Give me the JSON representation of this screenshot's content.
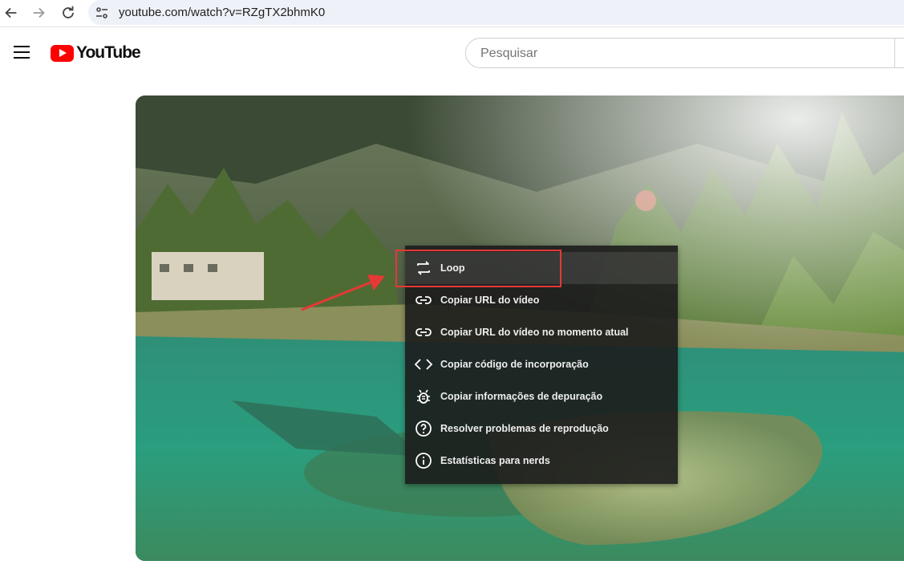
{
  "browser": {
    "url": "youtube.com/watch?v=RZgTX2bhmK0",
    "icons": [
      "back-icon",
      "forward-icon",
      "reload-icon",
      "site-info-icon"
    ]
  },
  "header": {
    "logo_text": "YouTube",
    "search_placeholder": "Pesquisar",
    "logo_color": "#ff0000"
  },
  "context_menu": {
    "items": [
      {
        "label": "Loop",
        "icon": "loop-icon",
        "highlighted": true
      },
      {
        "label": "Copiar URL do vídeo",
        "icon": "link-icon"
      },
      {
        "label": "Copiar URL do vídeo no momento atual",
        "icon": "link-icon"
      },
      {
        "label": "Copiar código de incorporação",
        "icon": "code-icon"
      },
      {
        "label": "Copiar informações de depuração",
        "icon": "bug-icon"
      },
      {
        "label": "Resolver problemas de reprodução",
        "icon": "help-icon"
      },
      {
        "label": "Estatísticas para nerds",
        "icon": "info-icon"
      }
    ]
  },
  "annotation": {
    "color": "#e53935"
  }
}
